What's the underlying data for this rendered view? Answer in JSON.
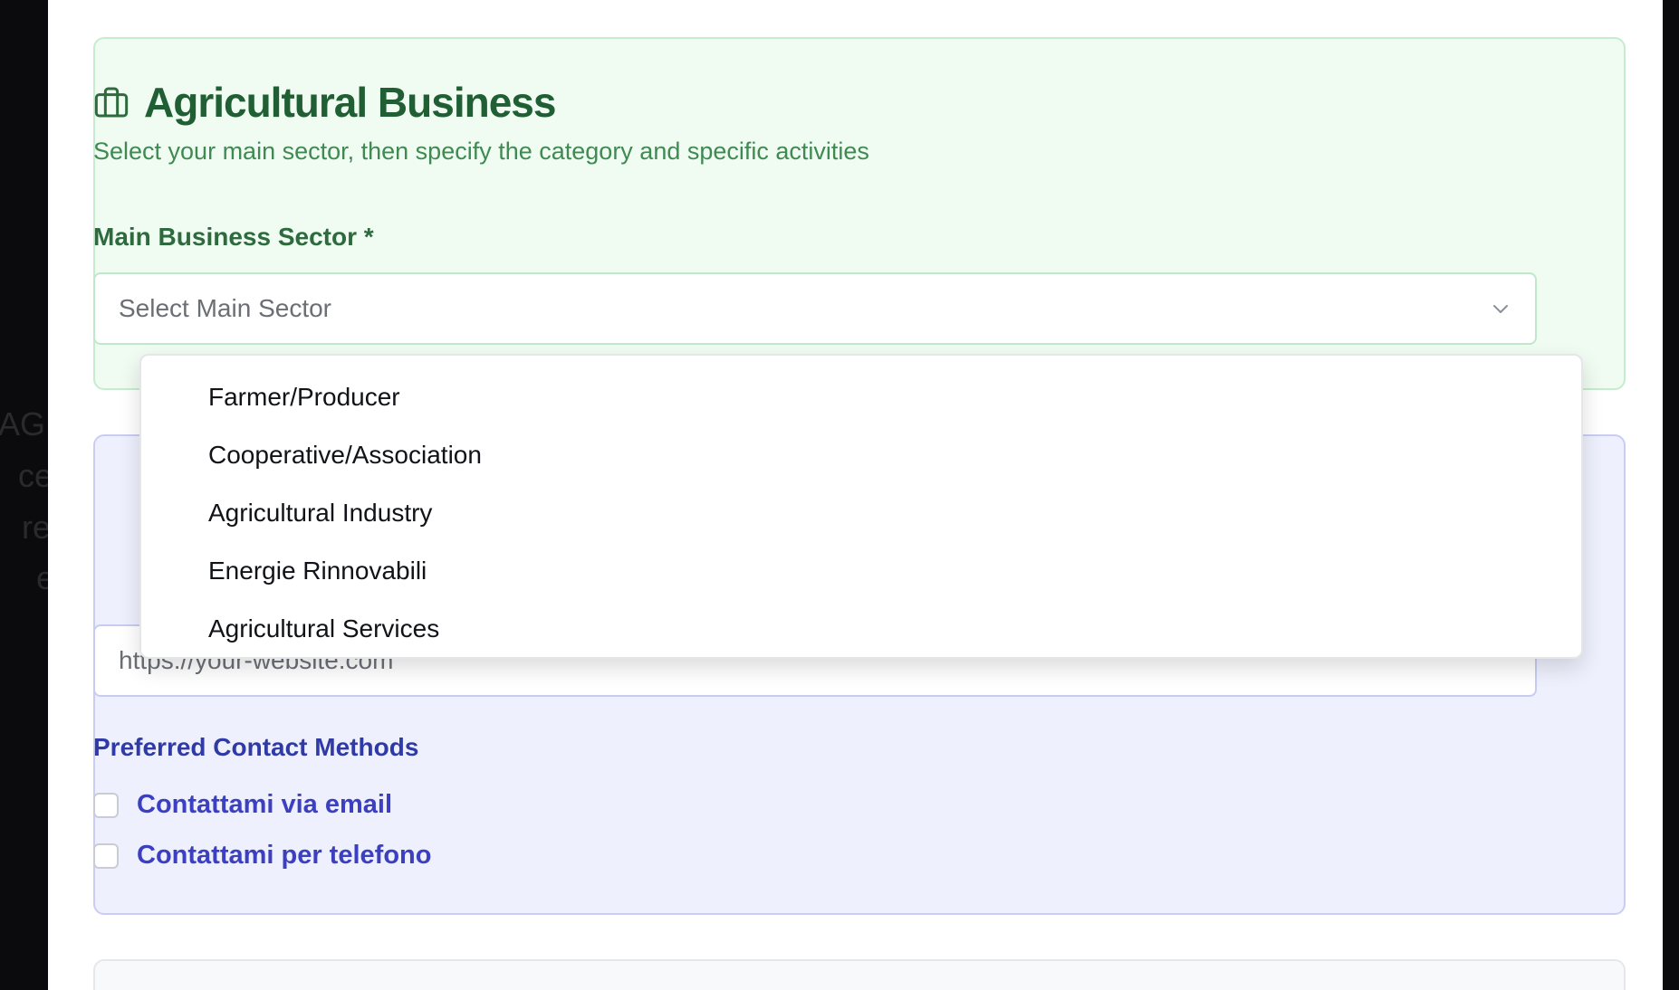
{
  "backdrop": {
    "left_fragments": [
      "AGR",
      "ce",
      "re",
      "e"
    ]
  },
  "business": {
    "icon": "briefcase-icon",
    "title": "Agricultural Business",
    "subtitle": "Select your main sector, then specify the category and specific activities",
    "sector_label": "Main Business Sector *",
    "select_placeholder": "Select Main Sector",
    "options": [
      "Farmer/Producer",
      "Cooperative/Association",
      "Agricultural Industry",
      "Energie Rinnovabili",
      "Agricultural Services"
    ]
  },
  "contact": {
    "website_placeholder": "https://your-website.com",
    "methods_label": "Preferred Contact Methods",
    "methods": [
      "Contattami via email",
      "Contattami per telefono"
    ]
  },
  "colors": {
    "business_bg": "#f0fbf2",
    "business_title": "#1f5f33",
    "contact_bg": "#eef0fd",
    "contact_text": "#3b3fc0"
  }
}
